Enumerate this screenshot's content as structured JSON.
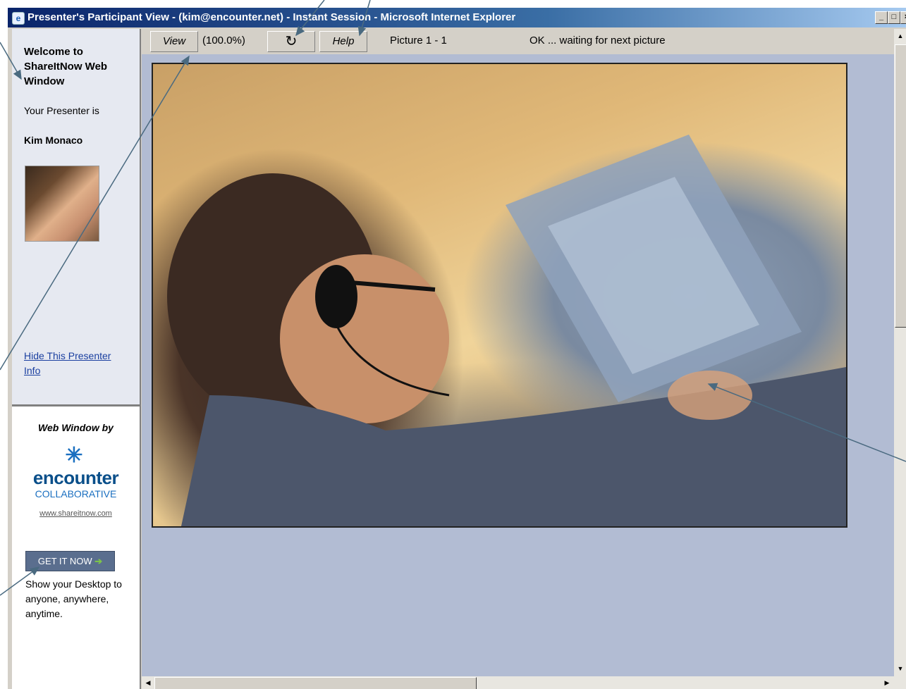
{
  "window": {
    "title": "Presenter's Participant View - (kim@encounter.net) - Instant Session - Microsoft Internet Explorer",
    "controls": {
      "minimize": "_",
      "maximize": "□",
      "close": "×"
    }
  },
  "sidebar": {
    "welcome": "Welcome to ShareItNow Web Window",
    "presenter_label": "Your Presenter is",
    "presenter_name": "Kim Monaco",
    "hide_link": "Hide This Presenter Info"
  },
  "ad": {
    "heading": "Web Window by",
    "brand": "encounter",
    "sub": "COLLABORATIVE",
    "url": "www.shareitnow.com",
    "button_label": "GET IT NOW",
    "button_arrow": "➔",
    "tagline": "Show your Desktop to anyone, anywhere, anytime."
  },
  "toolbar": {
    "view_label": "View",
    "zoom": "(100.0%)",
    "refresh_icon": "↻",
    "help_label": "Help",
    "picture_label": "Picture 1 - 1",
    "status": "OK ... waiting for next picture"
  },
  "colors": {
    "titlebar": "#0a246a",
    "sidebar_bg": "#e6e9f1",
    "main_bg": "#b2bcd3",
    "link": "#1a3fa0",
    "callout": "#4a6a80"
  }
}
